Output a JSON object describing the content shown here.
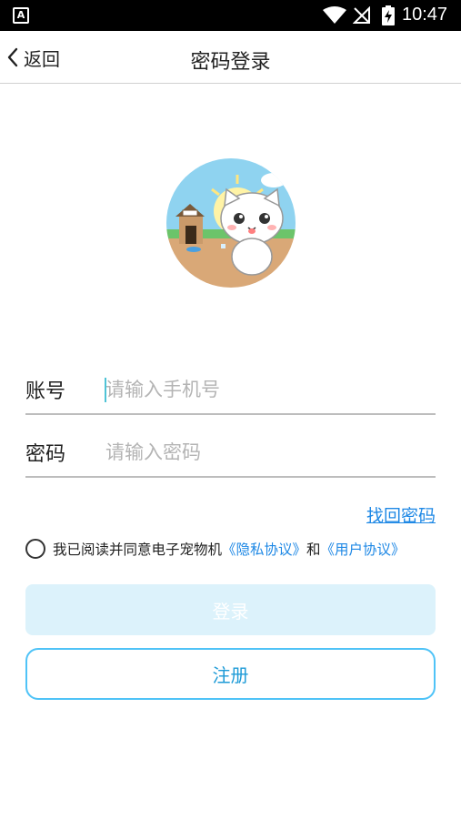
{
  "status_bar": {
    "app_icon_letter": "A",
    "time": "10:47"
  },
  "header": {
    "back_label": "返回",
    "title": "密码登录"
  },
  "form": {
    "account_label": "账号",
    "account_placeholder": "请输入手机号",
    "password_label": "密码",
    "password_placeholder": "请输入密码"
  },
  "forgot_password": "找回密码",
  "agreement": {
    "text": "我已阅读并同意电子宠物机",
    "privacy_link": "《隐私协议》",
    "and": "和",
    "user_link": "《用户协议》"
  },
  "buttons": {
    "login": "登录",
    "register": "注册"
  },
  "colors": {
    "accent": "#1e88e5",
    "login_bg": "#dcf2fb",
    "register_border": "#4fc3f7"
  }
}
